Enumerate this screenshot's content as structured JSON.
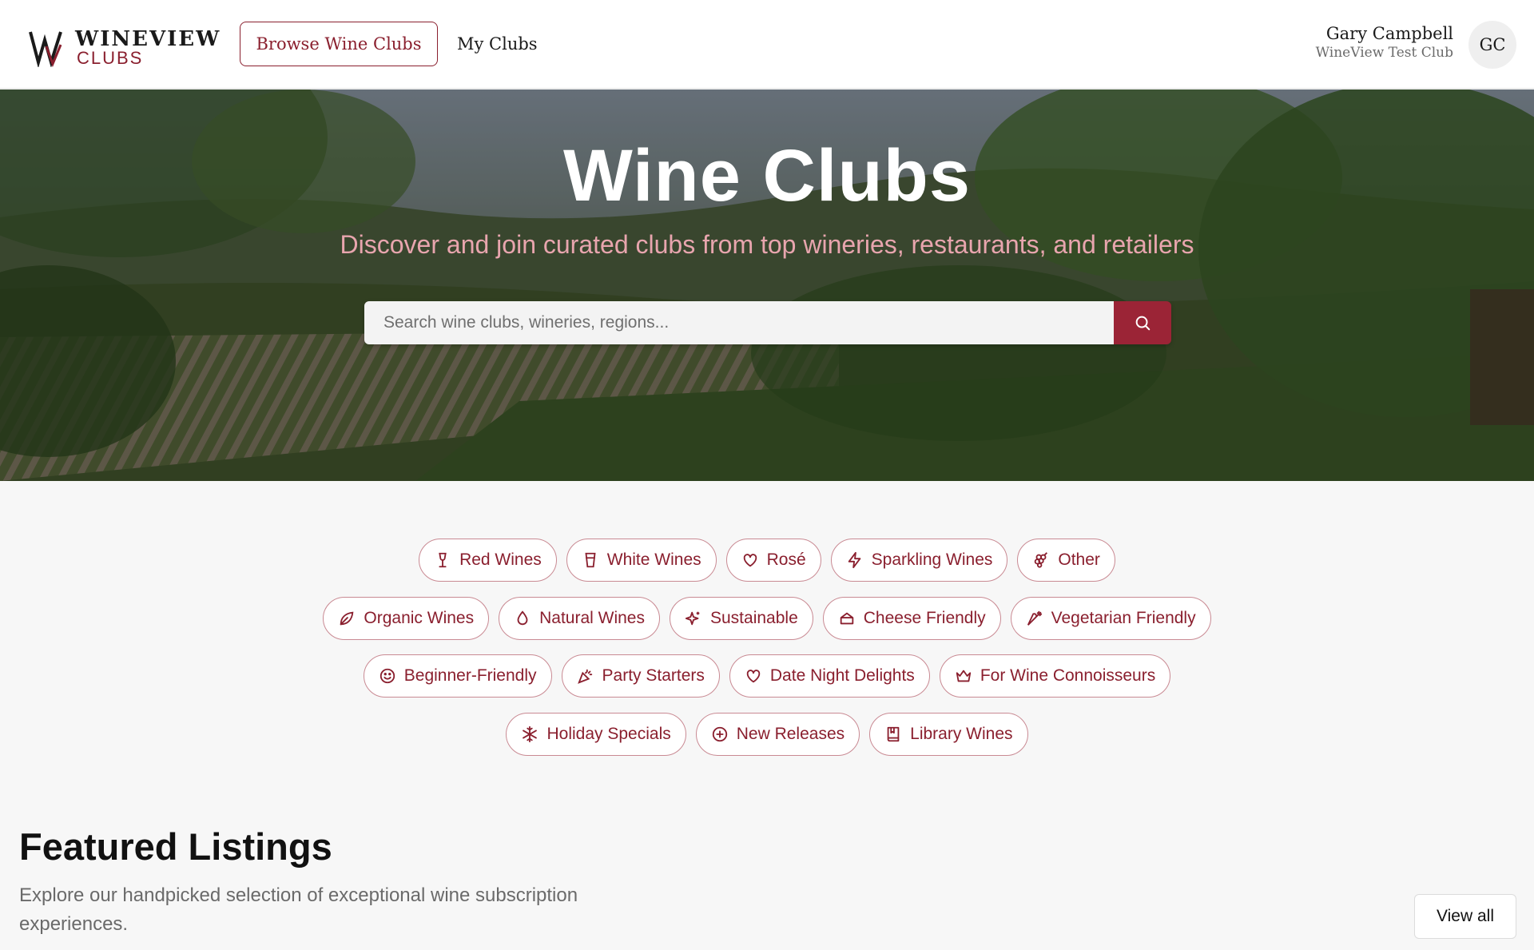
{
  "header": {
    "logo_line1": "WINEVIEW",
    "logo_line2": "CLUBS",
    "nav": {
      "browse_label": "Browse Wine Clubs",
      "myclubs_label": "My Clubs"
    },
    "user": {
      "name": "Gary Campbell",
      "club": "WineView Test Club",
      "initials": "GC"
    }
  },
  "hero": {
    "title": "Wine Clubs",
    "subtitle": "Discover and join curated clubs from top wineries, restaurants, and retailers",
    "search_placeholder": "Search wine clubs, wineries, regions...",
    "search_icon": "search-icon"
  },
  "categories": {
    "rows": [
      [
        {
          "label": "Red Wines",
          "icon": "wine-glass-icon"
        },
        {
          "label": "White Wines",
          "icon": "cup-icon"
        },
        {
          "label": "Rosé",
          "icon": "heart-icon"
        },
        {
          "label": "Sparkling Wines",
          "icon": "lightning-icon"
        },
        {
          "label": "Other",
          "icon": "grapes-icon"
        }
      ],
      [
        {
          "label": "Organic Wines",
          "icon": "leaf-icon"
        },
        {
          "label": "Natural Wines",
          "icon": "droplet-icon"
        },
        {
          "label": "Sustainable",
          "icon": "sparkles-icon"
        },
        {
          "label": "Cheese Friendly",
          "icon": "cheese-icon"
        },
        {
          "label": "Vegetarian Friendly",
          "icon": "carrot-icon"
        }
      ],
      [
        {
          "label": "Beginner-Friendly",
          "icon": "smile-icon"
        },
        {
          "label": "Party Starters",
          "icon": "party-popper-icon"
        },
        {
          "label": "Date Night Delights",
          "icon": "heart-icon"
        },
        {
          "label": "For Wine Connoisseurs",
          "icon": "crown-icon"
        }
      ],
      [
        {
          "label": "Holiday Specials",
          "icon": "snowflake-icon"
        },
        {
          "label": "New Releases",
          "icon": "plus-circle-icon"
        },
        {
          "label": "Library Wines",
          "icon": "book-icon"
        }
      ]
    ]
  },
  "featured": {
    "title": "Featured Listings",
    "description": "Explore our handpicked selection of exceptional wine subscription experiences.",
    "view_all_label": "View all"
  },
  "colors": {
    "accent": "#8a1f2e",
    "search_button": "#9b2436",
    "chip_border": "#c98a93",
    "hero_subtitle": "#e8a5ae"
  }
}
